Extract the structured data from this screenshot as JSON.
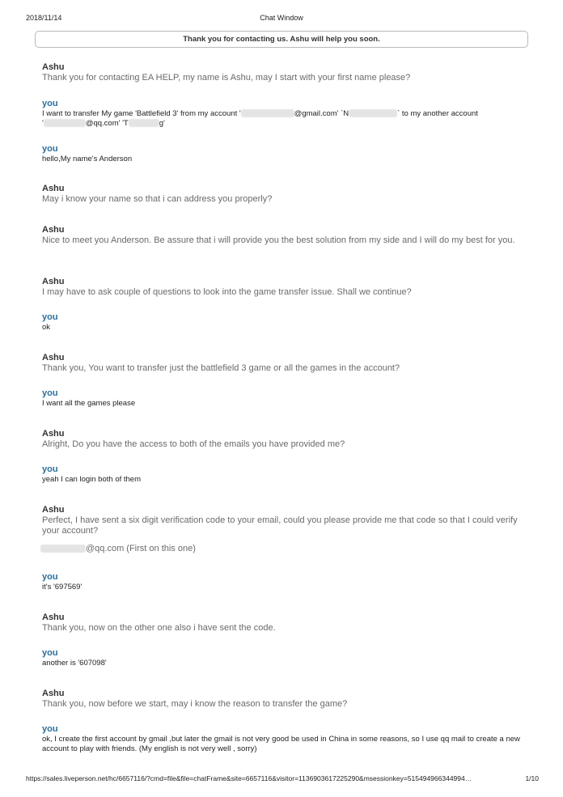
{
  "header": {
    "date": "2018/11/14",
    "title": "Chat Window"
  },
  "banner": "Thank you for contacting us. Ashu will help you soon.",
  "messages": [
    {
      "sender": "Ashu",
      "text": "Thank you for contacting EA HELP, my name is Ashu, may I start with your first name please?"
    },
    {
      "sender": "you",
      "line1_a": "I want to transfer My game 'Battlefield 3' from my account '",
      "line1_b": "@gmail.com' `N",
      "line1_c": "` to my another account",
      "line2_a": "'",
      "line2_b": "@qq.com' 'T",
      "line2_c": "g'"
    },
    {
      "sender": "you",
      "text": "hello,My name's Anderson"
    },
    {
      "sender": "Ashu",
      "text": "May i know your name so that i can address you properly?"
    },
    {
      "sender": "Ashu",
      "text": "Nice to meet you Anderson. Be assure that i will provide you the best solution from my side and I will do my best for you."
    },
    {
      "sender": "Ashu",
      "text": "I may have to ask couple of questions to look into the game transfer issue. Shall we continue?"
    },
    {
      "sender": "you",
      "text": "ok"
    },
    {
      "sender": "Ashu",
      "text": "Thank you, You want to transfer just the battlefield 3 game or all the games in the account?"
    },
    {
      "sender": "you",
      "text": "I want all the games please"
    },
    {
      "sender": "Ashu",
      "text": "Alright, Do you have the access to both of the emails you have provided me?"
    },
    {
      "sender": "you",
      "text": "yeah I can login both of them"
    },
    {
      "sender": "Ashu",
      "text": "Perfect, I have sent a six digit verification code to your email, could you please provide me that code so that I could verify your account?",
      "extra": "@qq.com (First on this one)"
    },
    {
      "sender": "you",
      "text": "it's '697569'"
    },
    {
      "sender": "Ashu",
      "text": "Thank you, now on the other one also i have sent the code."
    },
    {
      "sender": "you",
      "text": "another is '607098'"
    },
    {
      "sender": "Ashu",
      "text": "Thank you, now before we start, may i know the reason to transfer the game?"
    },
    {
      "sender": "you",
      "text": "ok, I create the first account by gmail ,but later the gmail is not very good be used in China in some reasons, so I use qq mail to create a new account to play with friends. (My english is not very well , sorry)"
    }
  ],
  "footer": {
    "url": "https://sales.liveperson.net/hc/6657116/?cmd=file&file=chatFrame&site=6657116&visitor=1136903617225290&msessionkey=515494966344994…",
    "page": "1/10"
  }
}
